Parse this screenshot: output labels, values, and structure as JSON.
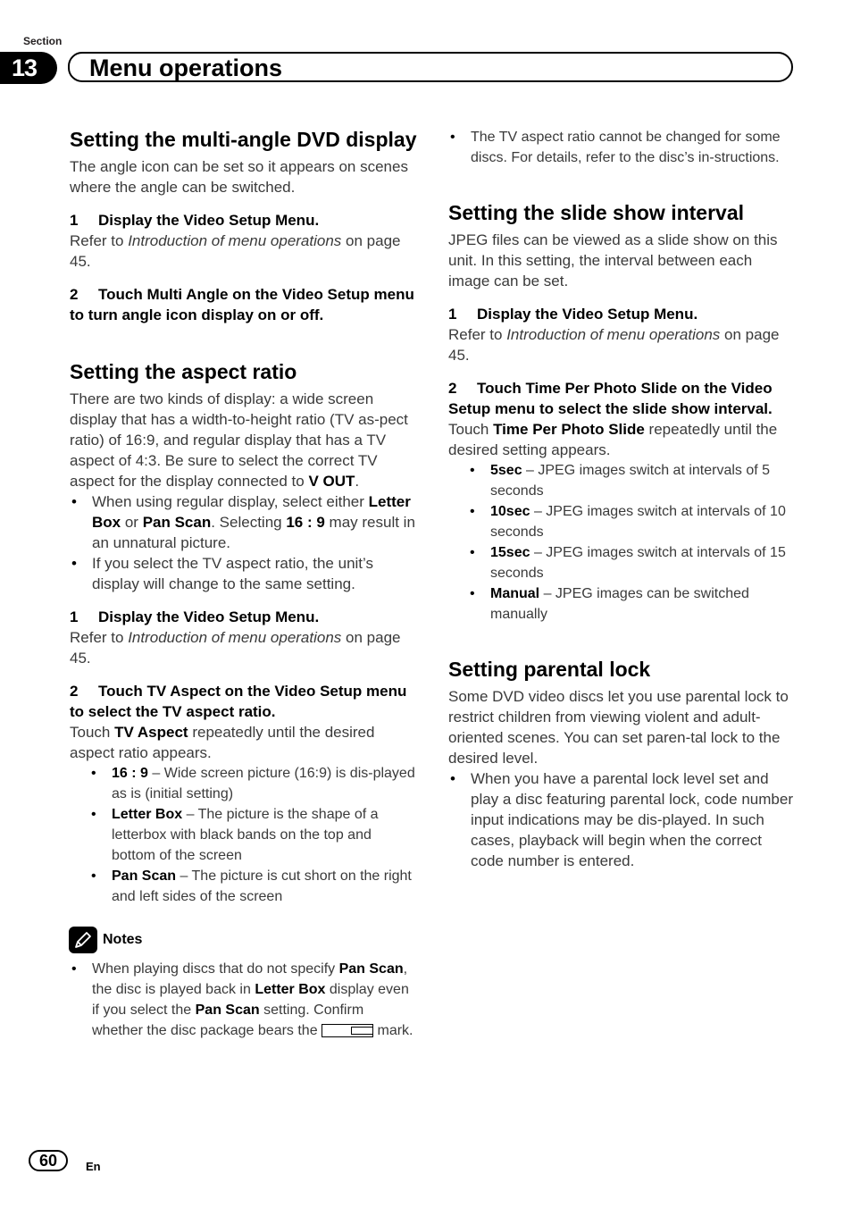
{
  "header": {
    "section_label": "Section",
    "section_number": "13",
    "title": "Menu operations"
  },
  "left": {
    "multi_angle": {
      "heading": "Setting the multi-angle DVD display",
      "intro": "The angle icon can be set so it appears on scenes where the angle can be switched.",
      "step1": {
        "num": "1",
        "text": "Display the Video Setup Menu."
      },
      "step1_ref": {
        "pre": "Refer to ",
        "italic": "Introduction of menu operations",
        "post": " on page 45."
      },
      "step2": {
        "num": "2",
        "text": "Touch Multi Angle on the Video Setup menu to turn angle icon display on or off."
      }
    },
    "aspect": {
      "heading": "Setting the aspect ratio",
      "intro_pre": "There are two kinds of display: a wide screen display that has a width-to-height ratio (TV as-pect ratio) of 16:9, and regular display that has a TV aspect of 4:3. Be sure to select the correct TV aspect for the display connected to ",
      "intro_bold": "V OUT",
      "intro_post": ".",
      "bullets": [
        {
          "t1": "When using regular display, select either ",
          "b1": "Letter Box",
          "t2": " or ",
          "b2": "Pan Scan",
          "t3": ". Selecting ",
          "b3": "16 : 9",
          "t4": " may result in an unnatural picture."
        },
        {
          "text": "If you select the TV aspect ratio, the unit’s display will change to the same setting."
        }
      ],
      "step1": {
        "num": "1",
        "text": "Display the Video Setup Menu."
      },
      "step1_ref": {
        "pre": "Refer to ",
        "italic": "Introduction of menu operations",
        "post": " on page 45."
      },
      "step2": {
        "num": "2",
        "text": "Touch TV Aspect on the Video Setup menu to select the TV aspect ratio."
      },
      "step2_body": {
        "pre": "Touch ",
        "bold": "TV Aspect",
        "post": " repeatedly until the desired aspect ratio appears."
      },
      "options": [
        {
          "name": "16 : 9",
          "desc": " – Wide screen picture (16:9) is dis-played as is (initial setting)"
        },
        {
          "name": "Letter Box",
          "desc": " – The picture is the shape of a letterbox with black bands on the top and bottom of the screen"
        },
        {
          "name": "Pan Scan",
          "desc": " – The picture is cut short on the right and left sides of the screen"
        }
      ]
    },
    "notes": {
      "label": "Notes",
      "icon": "pencil-icon",
      "item": {
        "t1": "When playing discs that do not specify ",
        "b1": "Pan Scan",
        "t2": ", the disc is played back in ",
        "b2": "Letter Box",
        "t3": " display even if you select the ",
        "b3": "Pan Scan",
        "t4": " setting. Confirm whether the disc package bears the ",
        "t5": " mark."
      }
    }
  },
  "right": {
    "note_bullet": "The TV aspect ratio cannot be changed for some discs. For details, refer to the disc’s in-structions.",
    "slide": {
      "heading": "Setting the slide show interval",
      "intro": "JPEG files can be viewed as a slide show on this unit. In this setting, the interval between each image can be set.",
      "step1": {
        "num": "1",
        "text": "Display the Video Setup Menu."
      },
      "step1_ref": {
        "pre": "Refer to ",
        "italic": "Introduction of menu operations",
        "post": " on page 45."
      },
      "step2": {
        "num": "2",
        "text": "Touch Time Per Photo Slide on the Video Setup menu to select the slide show interval."
      },
      "step2_body": {
        "pre": "Touch ",
        "bold": "Time Per Photo Slide",
        "post": " repeatedly until the desired setting appears."
      },
      "options": [
        {
          "name": "5sec",
          "desc": " – JPEG images switch at intervals of 5 seconds"
        },
        {
          "name": "10sec",
          "desc": " – JPEG images switch at intervals of 10 seconds"
        },
        {
          "name": "15sec",
          "desc": " – JPEG images switch at intervals of 15 seconds"
        },
        {
          "name": "Manual",
          "desc": " – JPEG images can be switched manually"
        }
      ]
    },
    "parental": {
      "heading": "Setting parental lock",
      "intro": "Some DVD video discs let you use parental lock to restrict children from viewing violent and adult-oriented scenes. You can set paren-tal lock to the desired level.",
      "bullet": "When you have a parental lock level set and play a disc featuring parental lock, code number input indications may be dis-played. In such cases, playback will begin when the correct code number is entered."
    }
  },
  "footer": {
    "page_number": "60",
    "language": "En"
  }
}
